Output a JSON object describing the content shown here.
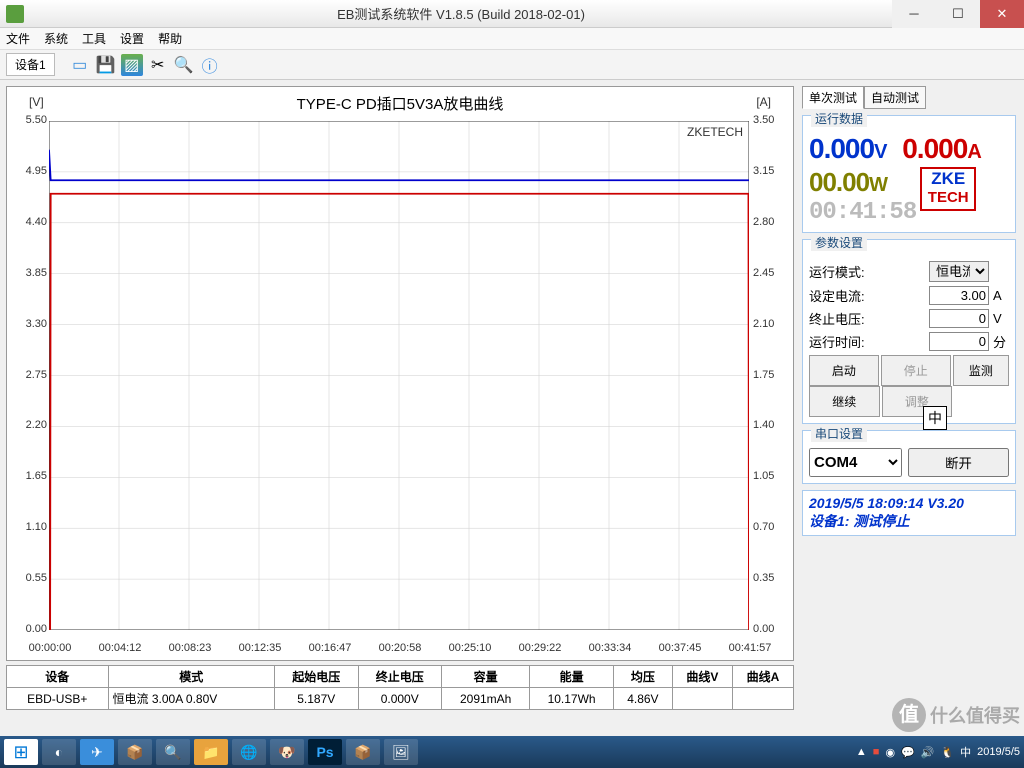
{
  "window": {
    "title": "EB测试系统软件 V1.8.5 (Build 2018-02-01)"
  },
  "menu": {
    "file": "文件",
    "system": "系统",
    "tool": "工具",
    "setting": "设置",
    "help": "帮助"
  },
  "toolbar": {
    "tab1": "设备1"
  },
  "chart_data": {
    "type": "line",
    "title": "TYPE-C PD插口5V3A放电曲线",
    "watermark": "ZKETECH",
    "xlabel": "",
    "x_ticks": [
      "00:00:00",
      "00:04:12",
      "00:08:23",
      "00:12:35",
      "00:16:47",
      "00:20:58",
      "00:25:10",
      "00:29:22",
      "00:33:34",
      "00:37:45",
      "00:41:57"
    ],
    "left_axis": {
      "label": "[V]",
      "min": 0.0,
      "max": 5.5,
      "ticks": [
        0.0,
        0.55,
        1.1,
        1.65,
        2.2,
        2.75,
        3.3,
        3.85,
        4.4,
        4.95,
        5.5
      ]
    },
    "right_axis": {
      "label": "[A]",
      "min": 0.0,
      "max": 3.5,
      "ticks": [
        0.0,
        0.35,
        0.7,
        1.05,
        1.4,
        1.75,
        2.1,
        2.45,
        2.8,
        3.15,
        3.5
      ]
    },
    "series": [
      {
        "name": "曲线V",
        "color": "#0000cc",
        "axis": "left",
        "x": [
          0,
          6,
          12,
          2517
        ],
        "y": [
          5.19,
          4.86,
          4.86,
          4.86
        ]
      },
      {
        "name": "曲线A",
        "color": "#cc0000",
        "axis": "right",
        "x": [
          0,
          4,
          6,
          2515,
          2517
        ],
        "y": [
          0.0,
          0.0,
          3.0,
          3.0,
          0.0
        ]
      }
    ],
    "x_range_sec": [
      0,
      2517
    ]
  },
  "table": {
    "headers": {
      "device": "设备",
      "mode": "模式",
      "start_v": "起始电压",
      "end_v": "终止电压",
      "capacity": "容量",
      "energy": "能量",
      "avg_v": "均压",
      "curve_v": "曲线V",
      "curve_a": "曲线A"
    },
    "row": {
      "device": "EBD-USB+",
      "mode": "恒电流 3.00A 0.80V",
      "start_v": "5.187V",
      "end_v": "0.000V",
      "capacity": "2091mAh",
      "energy": "10.17Wh",
      "avg_v": "4.86V"
    }
  },
  "right_panel": {
    "tabs": {
      "single": "单次测试",
      "auto": "自动测试"
    },
    "run_box_title": "运行数据",
    "display": {
      "v": "0.000",
      "v_unit": "V",
      "a": "0.000",
      "a_unit": "A",
      "w": "00.00",
      "w_unit": "W",
      "time": "00:41:58"
    },
    "logo": {
      "l1": "ZKE",
      "l2": "TECH"
    },
    "param_title": "参数设置",
    "mode_label": "运行模式:",
    "mode_value": "恒电流",
    "set_i_label": "设定电流:",
    "set_i_value": "3.00",
    "set_i_unit": "A",
    "end_v_label": "终止电压:",
    "end_v_value": "0",
    "end_v_unit": "V",
    "run_t_label": "运行时间:",
    "run_t_value": "0",
    "run_t_unit": "分",
    "btn": {
      "start": "启动",
      "stop": "停止",
      "monitor": "监测",
      "continue": "继续",
      "adjust": "调整"
    },
    "com_title": "串口设置",
    "com_value": "COM4",
    "com_btn": "断开",
    "status1": "2019/5/5 18:09:14  V3.20",
    "status2": "设备1: 测试停止"
  },
  "ime": "中",
  "taskbar": {
    "date": "2019/5/5"
  },
  "watermark_corner": {
    "badge": "值",
    "text": "什么值得买"
  }
}
